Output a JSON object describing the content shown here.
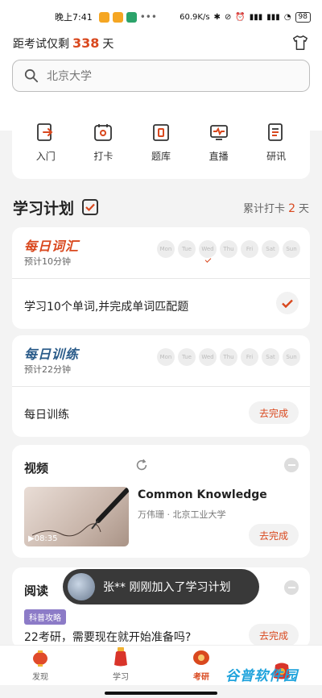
{
  "status_bar": {
    "time": "晚上7:41",
    "network_speed": "60.9K/s",
    "battery": "98"
  },
  "header": {
    "countdown_prefix": "距考试仅剩",
    "countdown_days": "338",
    "countdown_suffix": "天"
  },
  "search": {
    "placeholder": "北京大学"
  },
  "quick_entries": [
    {
      "label": "入门",
      "icon": "enter-icon"
    },
    {
      "label": "打卡",
      "icon": "calendar-checkin-icon"
    },
    {
      "label": "题库",
      "icon": "question-bank-icon"
    },
    {
      "label": "直播",
      "icon": "live-icon"
    },
    {
      "label": "研讯",
      "icon": "news-icon"
    }
  ],
  "plan": {
    "title": "学习计划",
    "count_prefix": "累计打卡",
    "count": "2",
    "count_suffix": "天"
  },
  "weekdays": [
    "Mon",
    "Tue",
    "Wed",
    "Thu",
    "Fri",
    "Sat",
    "Sun"
  ],
  "daily_words": {
    "brand": "每日词汇",
    "estimate": "预计10分钟",
    "task": "学习10个单词,并完成单词匹配题"
  },
  "daily_training": {
    "brand": "每日训练",
    "estimate": "预计22分钟",
    "task": "每日训练",
    "button": "去完成"
  },
  "video": {
    "section_title": "视频",
    "title": "Common Knowledge",
    "meta": "万伟珊 · 北京工业大学",
    "duration": "08:35",
    "button": "去完成"
  },
  "reading": {
    "section_title": "阅读",
    "tag": "科普攻略",
    "title": "22考研，需要现在就开始准备吗?",
    "button": "去完成"
  },
  "toast": {
    "text": "张** 刚刚加入了学习计划"
  },
  "tabs": [
    {
      "label": "发现"
    },
    {
      "label": "学习"
    },
    {
      "label": "考研"
    },
    {
      "label": ""
    }
  ],
  "watermark": "谷普软件园",
  "colors": {
    "accent": "#d9481e",
    "brand_blue": "#2b5c8a",
    "tag_purple": "#8c7bc7"
  }
}
